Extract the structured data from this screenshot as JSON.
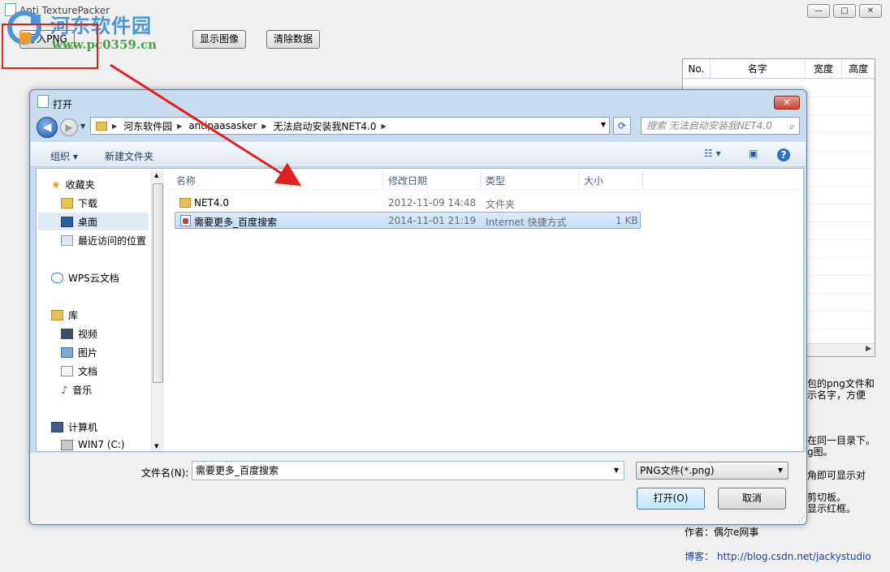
{
  "app": {
    "title": "Anti TexturePacker",
    "window_buttons": [
      "—",
      "□",
      "✕"
    ],
    "buttons": {
      "import_png": "导入PNG",
      "show_image": "显示图像",
      "clear_data": "清除数据"
    },
    "table": {
      "columns": [
        "No.",
        "名字",
        "宽度",
        "高度"
      ]
    },
    "help_lines": [
      "包的png文件和",
      "示名字，方便",
      "在同一目录下。",
      "g图。",
      "角即可显示对",
      "剪切板。",
      "显示红框。"
    ],
    "author": "作者：偶尔e网事",
    "blog_label": "博客：",
    "blog_url": "http://blog.csdn.net/jackystudio"
  },
  "watermark": {
    "name": "河东软件园",
    "url": "www.pc0359.cn"
  },
  "dialog": {
    "title": "打开",
    "close": "✕",
    "breadcrumbs": [
      "河东软件园",
      "antipaasasker",
      "无法启动安装我NET4.0"
    ],
    "search_placeholder": "搜索 无法启动安装我NET4.0",
    "toolbar": {
      "organize": "组织 ▾",
      "new_folder": "新建文件夹"
    },
    "nav": {
      "favorites": "收藏夹",
      "downloads": "下载",
      "desktop": "桌面",
      "recent": "最近访问的位置",
      "wps": "WPS云文档",
      "libraries": "库",
      "videos": "视频",
      "pictures": "图片",
      "documents": "文档",
      "music": "音乐",
      "computer": "计算机",
      "drive_c": "WIN7 (C:)"
    },
    "columns": {
      "name": "名称",
      "modified": "修改日期",
      "type": "类型",
      "size": "大小"
    },
    "files": [
      {
        "name": "NET4.0",
        "modified": "2012-11-09 14:48",
        "type": "文件夹",
        "size": "",
        "icon": "folder-icon"
      },
      {
        "name": "需要更多_百度搜索",
        "modified": "2014-11-01 21:19",
        "type": "Internet 快捷方式",
        "size": "1 KB",
        "icon": "internet-shortcut-icon"
      }
    ],
    "filename_label": "文件名(N):",
    "filename_value": "需要更多_百度搜索",
    "filter_value": "PNG文件(*.png)",
    "open_button": "打开(O)",
    "cancel_button": "取消"
  }
}
